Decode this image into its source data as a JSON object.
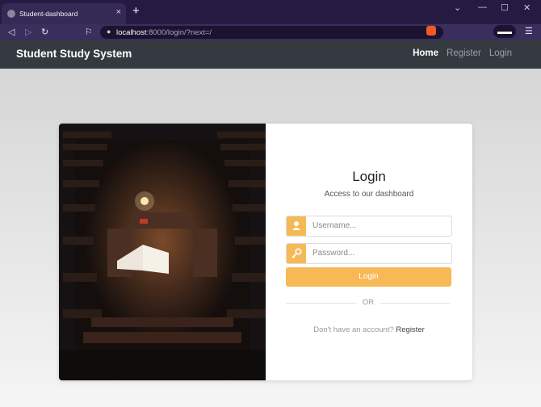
{
  "browser": {
    "tab_title": "Student-dashboard",
    "tab_close": "×",
    "new_tab": "+",
    "url_host": "localhost",
    "url_rest": ":8000/login/?next=/"
  },
  "navbar": {
    "brand": "Student Study System",
    "links": [
      {
        "label": "Home",
        "active": true
      },
      {
        "label": "Register",
        "active": false
      },
      {
        "label": "Login",
        "active": false
      }
    ]
  },
  "login": {
    "title": "Login",
    "subtitle": "Access to our dashboard",
    "username_placeholder": "Username...",
    "password_placeholder": "Password...",
    "submit_label": "Login",
    "divider": "OR",
    "no_account_text": "Don't have an account?",
    "register_link": "Register"
  },
  "colors": {
    "accent": "#f7b955",
    "navbar_bg": "#343a40",
    "browser_bg": "#261a43"
  },
  "icons": {
    "username": "user-icon",
    "password": "key-icon"
  }
}
